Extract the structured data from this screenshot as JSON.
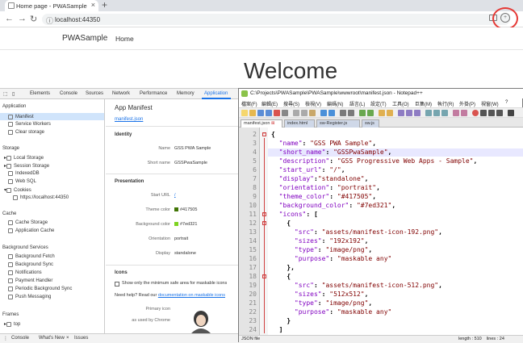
{
  "browser": {
    "tab_title": "Home page - PWASample",
    "url": "localhost:44350"
  },
  "app": {
    "brand": "PWASample",
    "nav_home": "Home",
    "welcome": "Welcome"
  },
  "devtools": {
    "tabs": [
      "Elements",
      "Console",
      "Sources",
      "Network",
      "Performance",
      "Memory",
      "Application"
    ],
    "sidebar": {
      "application_head": "Application",
      "application_items": [
        "Manifest",
        "Service Workers",
        "Clear storage"
      ],
      "storage_head": "Storage",
      "storage_items": [
        "Local Storage",
        "Session Storage",
        "IndexedDB",
        "Web SQL",
        "Cookies"
      ],
      "cookie_origin": "https://localhost:44350",
      "cache_head": "Cache",
      "cache_items": [
        "Cache Storage",
        "Application Cache"
      ],
      "bg_head": "Background Services",
      "bg_items": [
        "Background Fetch",
        "Background Sync",
        "Notifications",
        "Payment Handler",
        "Periodic Background Sync",
        "Push Messaging"
      ],
      "frames_head": "Frames",
      "frames_item": "top"
    },
    "main": {
      "title": "App Manifest",
      "manifest_link": "manifest.json",
      "identity_head": "Identity",
      "name_label": "Name",
      "name_value": "GSS PWA Sample",
      "short_name_label": "Short name",
      "short_name_value": "GSSPwaSample",
      "presentation_head": "Presentation",
      "start_url_label": "Start URL",
      "start_url_value": "/",
      "theme_label": "Theme color",
      "theme_value": "#417505",
      "theme_color": "#417505",
      "bg_label": "Background color",
      "bg_value": "#7ed321",
      "bg_color": "#7ed321",
      "orientation_label": "Orientation",
      "orientation_value": "portrait",
      "display_label": "Display",
      "display_value": "standalone",
      "icons_head": "Icons",
      "checkbox_label": "Show only the minimum safe area for maskable icons",
      "help_text": "Need help? Read our",
      "help_link": "documentation on maskable icons",
      "primary_icon_label": "Primary icon",
      "as_used_label": "as used by Chrome"
    },
    "bottom": [
      "Console",
      "What's New",
      "Issues"
    ]
  },
  "notepad": {
    "title": "C:\\Projects\\PWASample\\PWASample\\wwwroot\\manifest.json - Notepad++",
    "menu": [
      "檔案(F)",
      "編輯(E)",
      "搜尋(S)",
      "檢視(V)",
      "編碼(N)",
      "語言(L)",
      "設定(T)",
      "工具(O)",
      "巨集(M)",
      "執行(R)",
      "外掛(P)",
      "視窗(W)",
      "?"
    ],
    "tabs": [
      "manifest.json",
      "index.html",
      "sw-Register.js",
      "sw.js"
    ],
    "lines": [
      {
        "n": "2",
        "parts": [
          [
            "p",
            "{"
          ]
        ]
      },
      {
        "n": "3",
        "parts": [
          [
            "k",
            "  \"name\""
          ],
          [
            "p",
            ": "
          ],
          [
            "s",
            "\"GSS PWA Sample\""
          ],
          [
            "p",
            ","
          ]
        ]
      },
      {
        "n": "4",
        "parts": [
          [
            "k",
            "  \"short_name\""
          ],
          [
            "p",
            ": "
          ],
          [
            "s",
            "\"GSSPwaSample\""
          ],
          [
            "p",
            ","
          ]
        ]
      },
      {
        "n": "5",
        "parts": [
          [
            "k",
            "  \"description\""
          ],
          [
            "p",
            ": "
          ],
          [
            "s",
            "\"GSS Progressive Web Apps - Sample\""
          ],
          [
            "p",
            ","
          ]
        ]
      },
      {
        "n": "6",
        "parts": [
          [
            "k",
            "  \"start_url\""
          ],
          [
            "p",
            ": "
          ],
          [
            "s",
            "\"/\""
          ],
          [
            "p",
            ","
          ]
        ]
      },
      {
        "n": "7",
        "parts": [
          [
            "k",
            "  \"display\""
          ],
          [
            "p",
            ":"
          ],
          [
            "s",
            "\"standalone\""
          ],
          [
            "p",
            ","
          ]
        ]
      },
      {
        "n": "8",
        "parts": [
          [
            "k",
            "  \"orientation\""
          ],
          [
            "p",
            ": "
          ],
          [
            "s",
            "\"portrait\""
          ],
          [
            "p",
            ","
          ]
        ]
      },
      {
        "n": "9",
        "parts": [
          [
            "k",
            "  \"theme_color\""
          ],
          [
            "p",
            ": "
          ],
          [
            "s",
            "\"#417505\""
          ],
          [
            "p",
            ","
          ]
        ]
      },
      {
        "n": "10",
        "parts": [
          [
            "k",
            "  \"background_color\""
          ],
          [
            "p",
            ": "
          ],
          [
            "s",
            "\"#7ed321\""
          ],
          [
            "p",
            ","
          ]
        ]
      },
      {
        "n": "11",
        "parts": [
          [
            "k",
            "  \"icons\""
          ],
          [
            "p",
            ": ["
          ]
        ]
      },
      {
        "n": "12",
        "parts": [
          [
            "p",
            "    {"
          ]
        ]
      },
      {
        "n": "13",
        "parts": [
          [
            "k",
            "      \"src\""
          ],
          [
            "p",
            ": "
          ],
          [
            "s",
            "\"assets/manifest-icon-192.png\""
          ],
          [
            "p",
            ","
          ]
        ]
      },
      {
        "n": "14",
        "parts": [
          [
            "k",
            "      \"sizes\""
          ],
          [
            "p",
            ": "
          ],
          [
            "s",
            "\"192x192\""
          ],
          [
            "p",
            ","
          ]
        ]
      },
      {
        "n": "15",
        "parts": [
          [
            "k",
            "      \"type\""
          ],
          [
            "p",
            ": "
          ],
          [
            "s",
            "\"image/png\""
          ],
          [
            "p",
            ","
          ]
        ]
      },
      {
        "n": "16",
        "parts": [
          [
            "k",
            "      \"purpose\""
          ],
          [
            "p",
            ": "
          ],
          [
            "s",
            "\"maskable any\""
          ]
        ]
      },
      {
        "n": "17",
        "parts": [
          [
            "p",
            "    },"
          ]
        ]
      },
      {
        "n": "18",
        "parts": [
          [
            "p",
            "    {"
          ]
        ]
      },
      {
        "n": "19",
        "parts": [
          [
            "k",
            "      \"src\""
          ],
          [
            "p",
            ": "
          ],
          [
            "s",
            "\"assets/manifest-icon-512.png\""
          ],
          [
            "p",
            ","
          ]
        ]
      },
      {
        "n": "20",
        "parts": [
          [
            "k",
            "      \"sizes\""
          ],
          [
            "p",
            ": "
          ],
          [
            "s",
            "\"512x512\""
          ],
          [
            "p",
            ","
          ]
        ]
      },
      {
        "n": "21",
        "parts": [
          [
            "k",
            "      \"type\""
          ],
          [
            "p",
            ": "
          ],
          [
            "s",
            "\"image/png\""
          ],
          [
            "p",
            ","
          ]
        ]
      },
      {
        "n": "22",
        "parts": [
          [
            "k",
            "      \"purpose\""
          ],
          [
            "p",
            ": "
          ],
          [
            "s",
            "\"maskable any\""
          ]
        ]
      },
      {
        "n": "23",
        "parts": [
          [
            "p",
            "    }"
          ]
        ]
      },
      {
        "n": "24",
        "parts": [
          [
            "p",
            "  ]"
          ]
        ]
      }
    ],
    "status_left": "JSON file",
    "status_right": "length : 510    lines : 24"
  }
}
